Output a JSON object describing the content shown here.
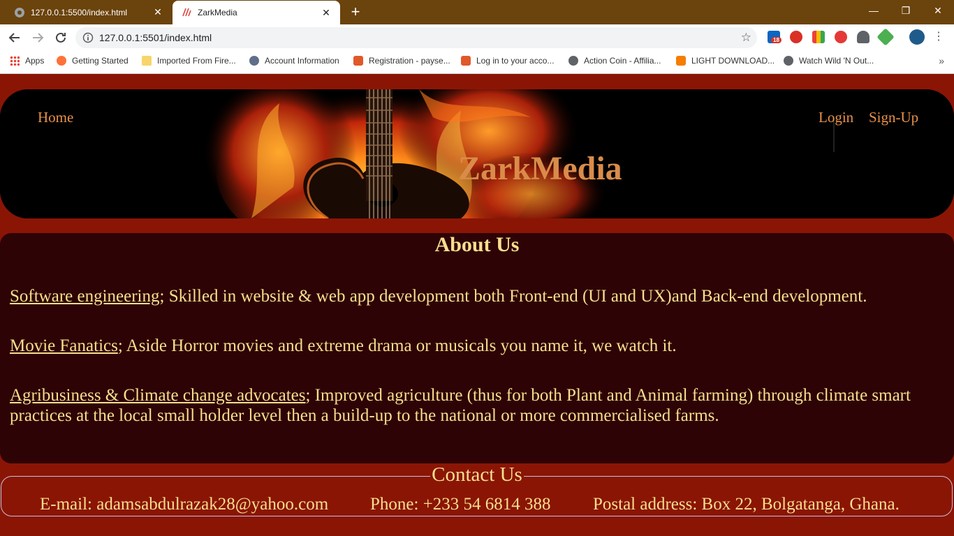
{
  "browser": {
    "tabs": [
      {
        "label": "127.0.0.1:5500/index.html",
        "active": false
      },
      {
        "label": "ZarkMedia",
        "active": true
      }
    ],
    "new_tab": "+",
    "window_controls": {
      "minimize": "—",
      "restore": "❐",
      "close": "✕"
    },
    "url": "127.0.0.1:5501/index.html",
    "linkedin_badge": "18",
    "bookmarks": [
      {
        "label": "Apps",
        "icon": "apps-grid-icon"
      },
      {
        "label": "Getting Started",
        "icon": "firefox-icon"
      },
      {
        "label": "Imported From Fire...",
        "icon": "folder-icon"
      },
      {
        "label": "Account Information",
        "icon": "account-icon"
      },
      {
        "label": "Registration - payse...",
        "icon": "payse-icon"
      },
      {
        "label": "Log in to your acco...",
        "icon": "payse-icon"
      },
      {
        "label": "Action Coin - Affilia...",
        "icon": "globe-icon"
      },
      {
        "label": "LIGHT DOWNLOAD...",
        "icon": "blogger-icon"
      },
      {
        "label": "Watch Wild 'N Out...",
        "icon": "globe-icon"
      }
    ],
    "bookmarks_overflow": "»"
  },
  "page": {
    "nav": {
      "home": "Home",
      "login": "Login",
      "signup": "Sign-Up"
    },
    "site_title": "ZarkMedia",
    "about": {
      "title": "About Us",
      "items": [
        {
          "term": "Software engineering",
          "text": "; Skilled in website & web app development both Front-end (UI and UX)and Back-end development."
        },
        {
          "term": "Movie Fanatics",
          "text": "; Aside Horror movies and extreme drama or musicals you name it, we watch it."
        },
        {
          "term": "Agribusiness & Climate change advocates",
          "text": "; Improved agriculture (thus for both Plant and Animal farming) through climate smart practices at the local small holder level then a build-up to the national or more commercialised farms."
        }
      ]
    },
    "contact": {
      "title": "Contact Us",
      "email": "E-mail: adamsabdulrazak28@yahoo.com",
      "phone": "Phone: +233 54 6814 388",
      "postal": "Postal address: Box 22, Bolgatanga, Ghana."
    },
    "colors": {
      "background": "#8a1505",
      "panel": "#2e0305",
      "text": "#f7df8e",
      "nav_link": "#e8914a",
      "title": "#d98c4a"
    }
  }
}
